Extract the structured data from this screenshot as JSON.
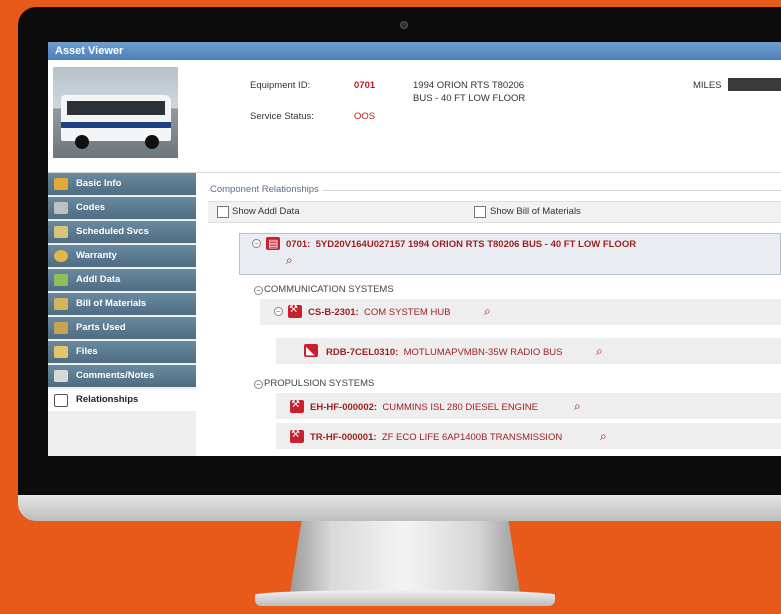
{
  "window": {
    "title": "Asset Viewer"
  },
  "header": {
    "equipment_id_label": "Equipment ID:",
    "equipment_id": "0701",
    "equipment_desc_line1": "1994 ORION RTS T80206",
    "equipment_desc_line2": "BUS - 40 FT LOW FLOOR",
    "service_status_label": "Service Status:",
    "service_status": "OOS",
    "miles_label": "MILES"
  },
  "sidebar": {
    "items": [
      {
        "label": "Basic Info",
        "icon": "info-icon"
      },
      {
        "label": "Codes",
        "icon": "codes-icon"
      },
      {
        "label": "Scheduled Svcs",
        "icon": "wrench-icon"
      },
      {
        "label": "Warranty",
        "icon": "warranty-icon"
      },
      {
        "label": "Addl Data",
        "icon": "data-icon"
      },
      {
        "label": "Bill of Materials",
        "icon": "bom-icon"
      },
      {
        "label": "Parts Used",
        "icon": "parts-icon"
      },
      {
        "label": "Files",
        "icon": "folder-icon"
      },
      {
        "label": "Comments/Notes",
        "icon": "notes-icon"
      },
      {
        "label": "Relationships",
        "icon": "relationships-icon"
      }
    ]
  },
  "relationships": {
    "section_title": "Component Relationships",
    "show_addl_data_label": "Show Addl Data",
    "show_bom_label": "Show Bill of Materials",
    "root": {
      "id": "0701:",
      "desc": "5YD20V164U027157 1994 ORION RTS T80206 BUS - 40 FT LOW FLOOR"
    },
    "groups": [
      {
        "name": "COMMUNICATION SYSTEMS",
        "items": [
          {
            "id": "CS-B-2301:",
            "desc": "COM SYSTEM HUB"
          },
          {
            "id": "RDB-7CEL0310:",
            "desc": "MOTLUMAPVMBN-35W RADIO BUS"
          }
        ]
      },
      {
        "name": "PROPULSION SYSTEMS",
        "items": [
          {
            "id": "EH-HF-000002:",
            "desc": "CUMMINS ISL 280 DIESEL ENGINE"
          },
          {
            "id": "TR-HF-000001:",
            "desc": "ZF ECO LIFE 6AP1400B TRANSMISSION"
          }
        ]
      }
    ]
  },
  "colors": {
    "background": "#e85a1a",
    "titlebar": "#4d7fb8",
    "nav": "#56748a",
    "accent_red": "#c21b1b"
  }
}
